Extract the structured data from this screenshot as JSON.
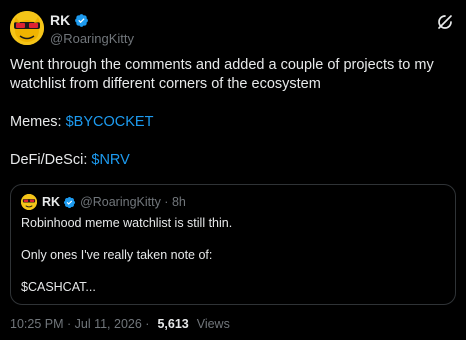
{
  "author": {
    "name": "RK",
    "handle": "@RoaringKitty"
  },
  "tweet": {
    "line1": "Went through the comments and added a couple of projects to my watchlist from different corners of the ecosystem",
    "memes_label": "Memes: ",
    "memes_tag": "$BYCOCKET",
    "defi_label": "DeFi/DeSci: ",
    "defi_tag": "$NRV"
  },
  "quote": {
    "name": "RK",
    "handle_time": "@RoaringKitty · 8h",
    "line1": "Robinhood meme watchlist is still thin.",
    "line2": "Only ones I've really taken note of:",
    "line3": "$CASHCAT..."
  },
  "meta": {
    "timestamp": "10:25 PM · Jul 11, 2026 ·",
    "views_count": "5,613",
    "views_label": "Views"
  },
  "colors": {
    "accent": "#1d9bf0",
    "text": "#e7e9ea",
    "muted": "#71767b",
    "border": "#2f3336"
  },
  "icons": {
    "verified": "verified-badge-icon",
    "grok": "grok-icon"
  }
}
